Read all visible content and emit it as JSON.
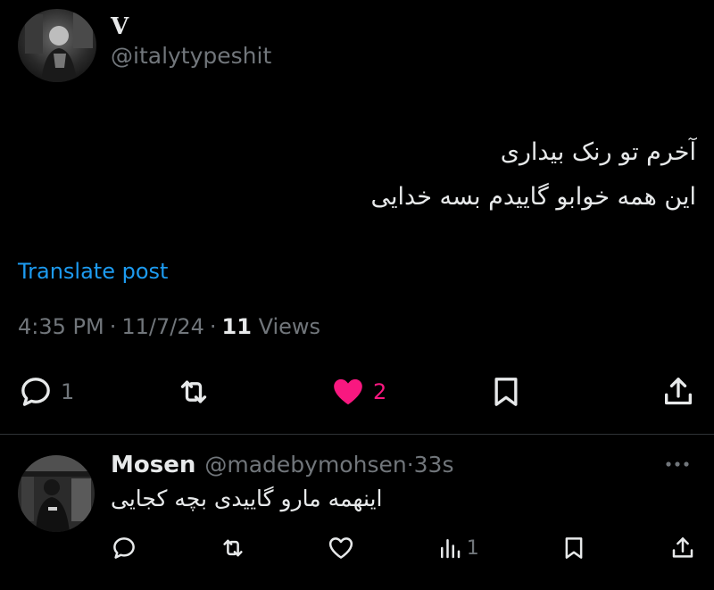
{
  "post": {
    "author": {
      "display_name": "V",
      "handle": "@italytypeshit"
    },
    "body_lines": [
      "آخرم تو رنک بیداری",
      "این همه خوابو گاییدم بسه خدایی"
    ],
    "translate_label": "Translate post",
    "time": "4:35 PM",
    "date": "11/7/24",
    "separator": "·",
    "views_count": "11",
    "views_label": "Views",
    "actions": {
      "reply": {
        "icon": "reply-icon",
        "count": "1"
      },
      "repost": {
        "icon": "repost-icon",
        "count": ""
      },
      "like": {
        "icon": "heart-filled-icon",
        "count": "2",
        "color": "#f91880"
      },
      "bookmark": {
        "icon": "bookmark-icon"
      },
      "share": {
        "icon": "share-icon"
      }
    }
  },
  "reply": {
    "display_name": "Mosen",
    "handle": "@madebymohsen",
    "time_ago": "33s",
    "separator": "·",
    "text": "اینهمه مارو گاییدی بچه کجایی",
    "actions": {
      "reply": {
        "icon": "reply-icon",
        "count": ""
      },
      "repost": {
        "icon": "repost-icon",
        "count": ""
      },
      "like": {
        "icon": "heart-icon",
        "count": ""
      },
      "views": {
        "icon": "views-icon",
        "count": "1"
      },
      "bookmark": {
        "icon": "bookmark-icon"
      },
      "share": {
        "icon": "share-icon"
      }
    }
  },
  "colors": {
    "background": "#000000",
    "text": "#e7e9ea",
    "secondary": "#71767b",
    "link": "#1d9bf0",
    "like": "#f91880",
    "divider": "#2f3336"
  }
}
